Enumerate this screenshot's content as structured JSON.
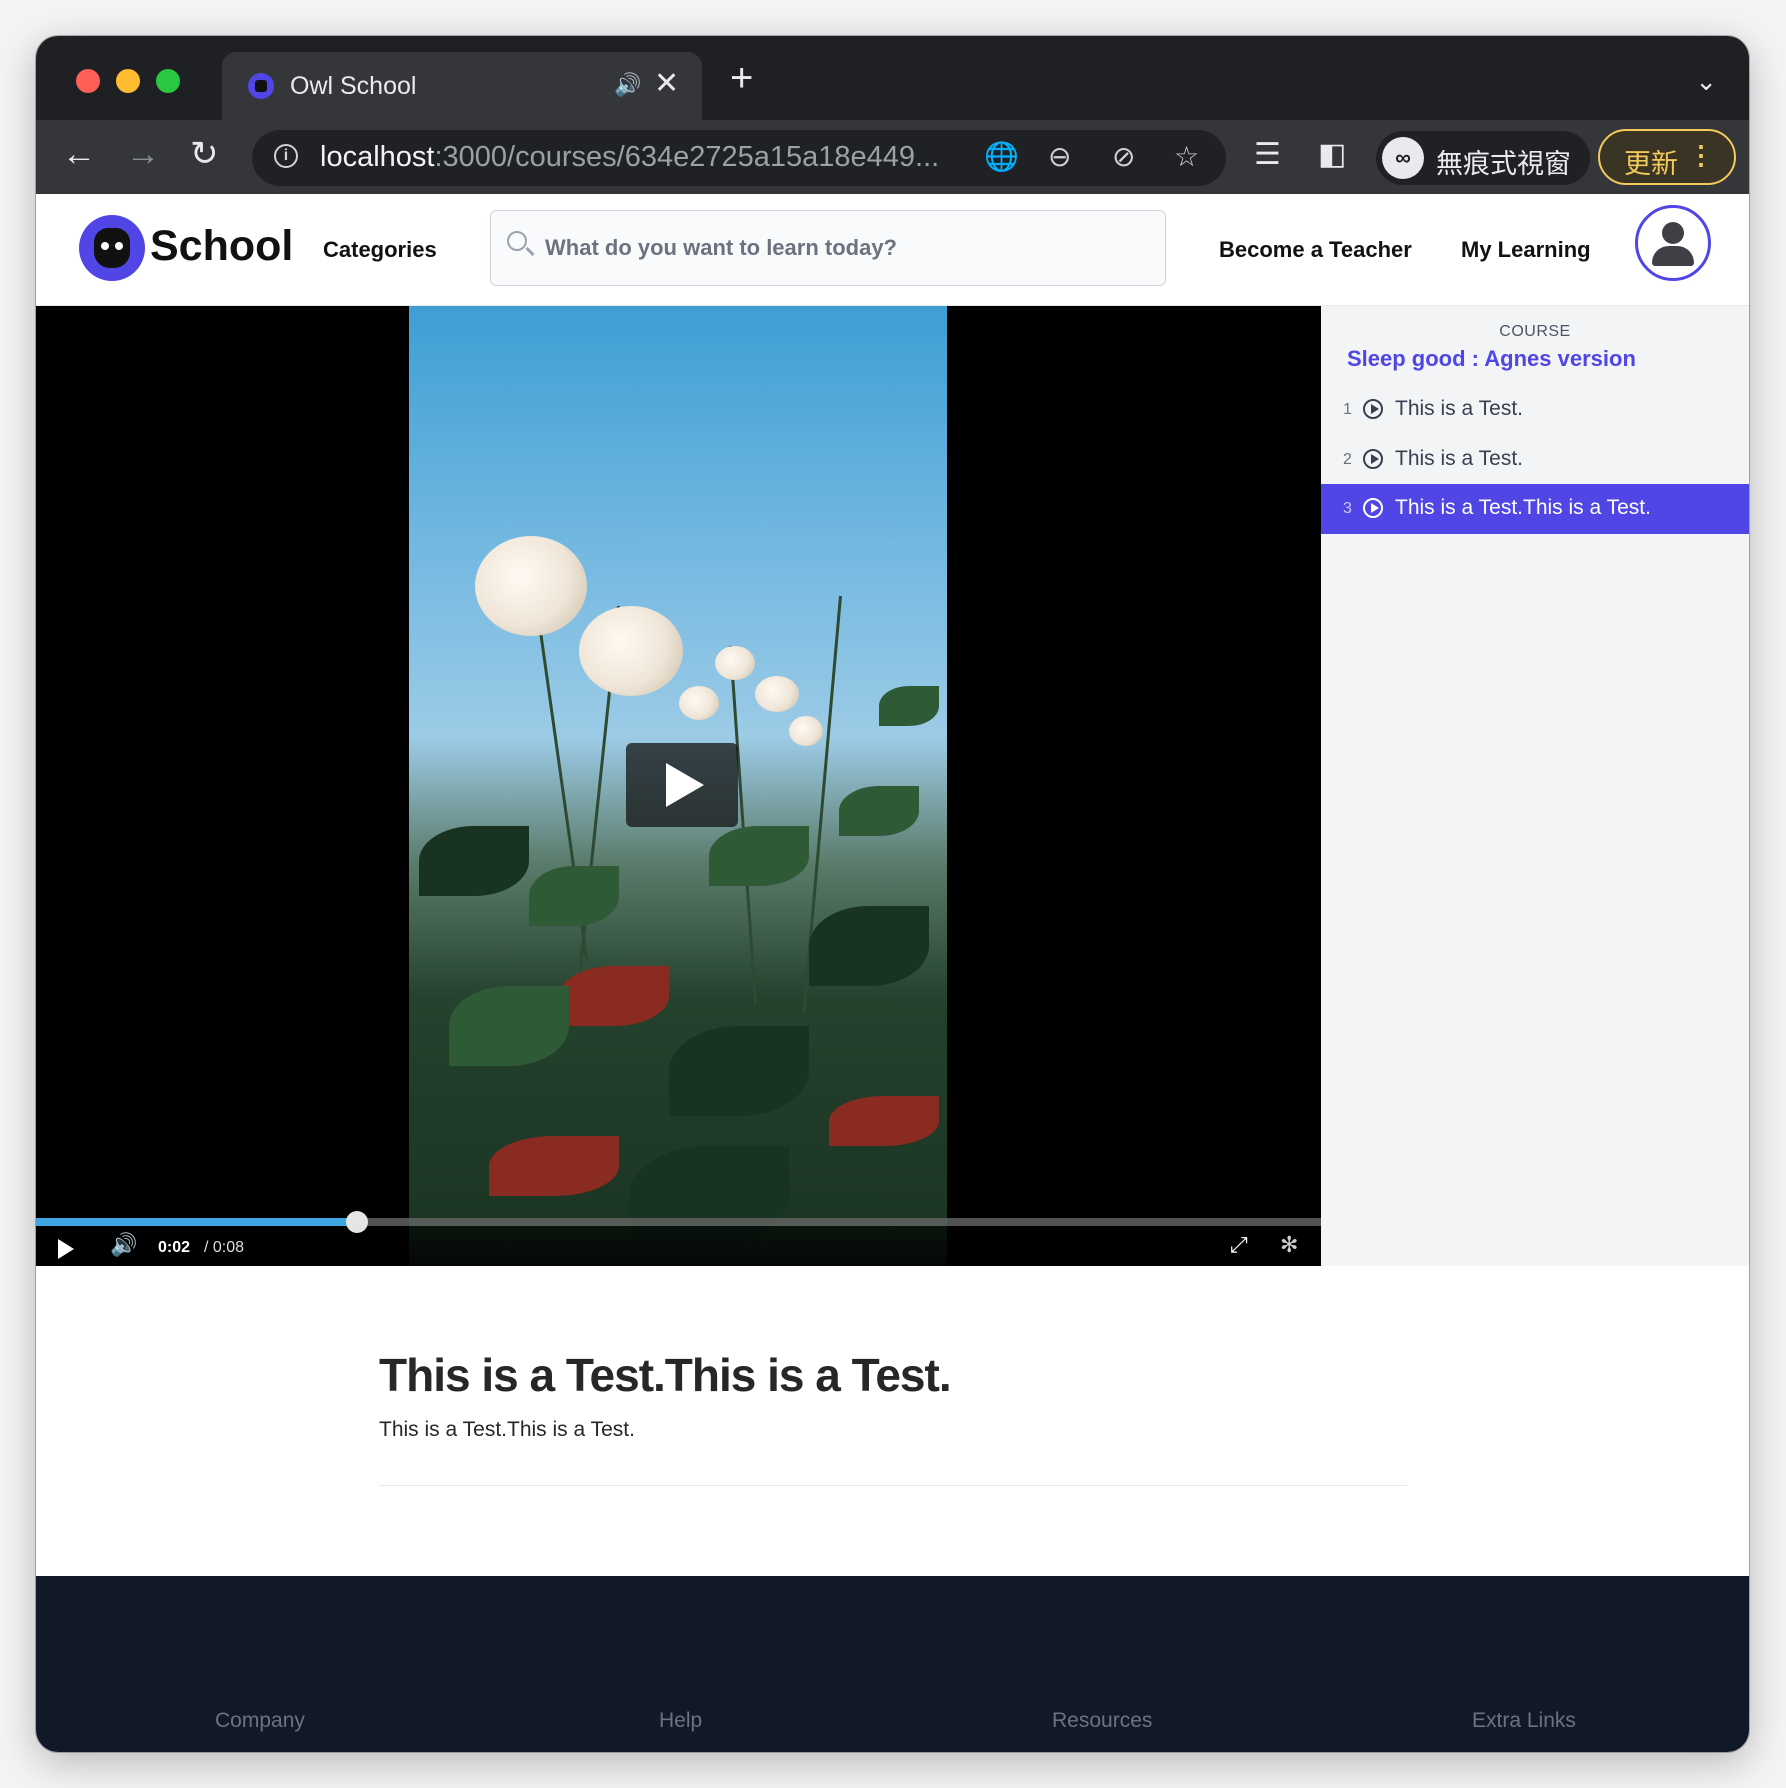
{
  "browser": {
    "tab_title": "Owl School",
    "url_host": "localhost",
    "url_path": ":3000/courses/634e2725a15a18e449...",
    "incognito_label": "無痕式視窗",
    "update_label": "更新",
    "colors": {
      "tabstrip": "#1f2023",
      "toolbar": "#35363a",
      "update_accent": "#f3c95b"
    }
  },
  "header": {
    "logo_text": "School",
    "categories_label": "Categories",
    "search_placeholder": "What do you want to learn today?",
    "become_teacher_label": "Become a Teacher",
    "my_learning_label": "My Learning",
    "brand_color": "#4f46e5"
  },
  "player": {
    "current_time": "0:02",
    "duration": "/ 0:08",
    "progress_fraction": 0.25
  },
  "sidebar": {
    "course_label": "COURSE",
    "course_title": "Sleep good : Agnes version",
    "lessons": [
      {
        "number": "1",
        "title": "This is a Test."
      },
      {
        "number": "2",
        "title": "This is a Test."
      },
      {
        "number": "3",
        "title": "This is a Test.This is a Test."
      }
    ],
    "active_lesson": 3
  },
  "lesson": {
    "heading": "This is a Test.This is a Test.",
    "description": "This is a Test.This is a Test."
  },
  "footer": {
    "columns": [
      "Company",
      "Help",
      "Resources",
      "Extra Links"
    ]
  }
}
